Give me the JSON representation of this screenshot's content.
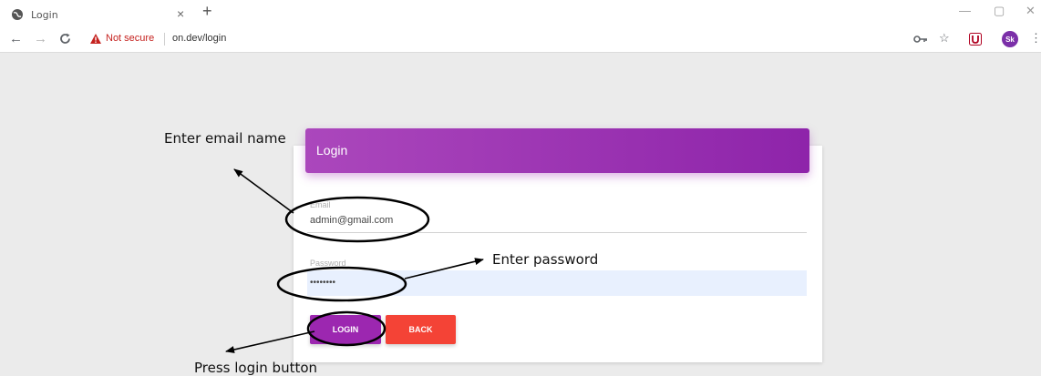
{
  "browser": {
    "tab_title": "Login",
    "tab_close": "×",
    "new_tab": "+",
    "security_text": "Not secure",
    "url": "on.dev/login",
    "avatar_initials": "Sk",
    "window_controls": {
      "minimize": "—",
      "restore": "▢",
      "close": "✕"
    }
  },
  "login_form": {
    "title": "Login",
    "email_label": "Email",
    "email_value": "admin@gmail.com",
    "password_label": "Password",
    "password_value": "••••••••",
    "login_button": "LOGIN",
    "back_button": "BACK"
  },
  "annotations": {
    "email": "Enter email name",
    "password": "Enter password",
    "login": "Press login button"
  },
  "colors": {
    "header": "#9c27b0",
    "login_button": "#9c27b0",
    "back_button": "#f44336",
    "password_field_bg": "#e8f0fe",
    "avatar": "#7b2fa8"
  },
  "icons": [
    "globe-icon",
    "close-icon",
    "plus-icon",
    "back-arrow-icon",
    "forward-arrow-icon",
    "reload-icon",
    "warning-icon",
    "key-icon",
    "star-icon",
    "extension-icon",
    "menu-icon"
  ]
}
